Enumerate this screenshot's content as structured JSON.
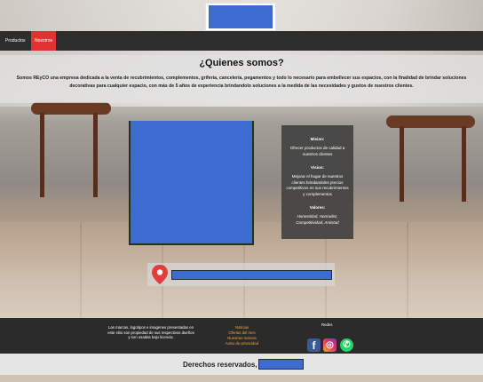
{
  "nav": {
    "items": [
      {
        "label": "Productos"
      },
      {
        "label": "Nosotros"
      }
    ]
  },
  "about": {
    "title": "¿Quienes somos?",
    "text": "Somos REyCO una empresa dedicada a la venta de recubrimientos, complementos, grifería, cancelería, pegamentos y todo lo necesario para embellecer sus espacios, con la finalidad de brindar soluciones decorativas para cualquier espacio, con más de 5 años de experiencia brindandolo soluciones a la medida de las necesidades y gustos de nuestros clientes."
  },
  "info": {
    "mision_title": "Mision:",
    "mision_text": "Ofrecer productos de calidad a nuestros clientes",
    "vision_title": "Vision:",
    "vision_text": "Mejorar el hogar de nuestros clientes brindandoles precios competitivos en sus recubrimientos y complementos",
    "valores_title": "Valores:",
    "valores_text": "Honestidad, Honradez, Competitividad, Amistad"
  },
  "footer": {
    "notice": "Las marcas, logotipos e imagenes presentadas en este sitio son propiedad de sus respectivos dueños y son usadas bajo licencia.",
    "links": [
      {
        "label": "Noticias"
      },
      {
        "label": "Ofertas del mes"
      },
      {
        "label": "Nuestras marcas"
      },
      {
        "label": "Aviso de privacidad"
      }
    ],
    "social_title": "Redes",
    "social": {
      "facebook_icon": "facebook-icon",
      "instagram_icon": "instagram-icon",
      "whatsapp_icon": "whatsapp-icon",
      "facebook_glyph": "f",
      "instagram_glyph": "◎",
      "whatsapp_glyph": "✆"
    }
  },
  "copyright": {
    "text": "Derechos reservados, ©"
  },
  "colors": {
    "accent": "#e23131",
    "placeholder": "#3d6cd0",
    "footer_link": "#f2a63a",
    "nav_bg": "#2d2d2d"
  }
}
